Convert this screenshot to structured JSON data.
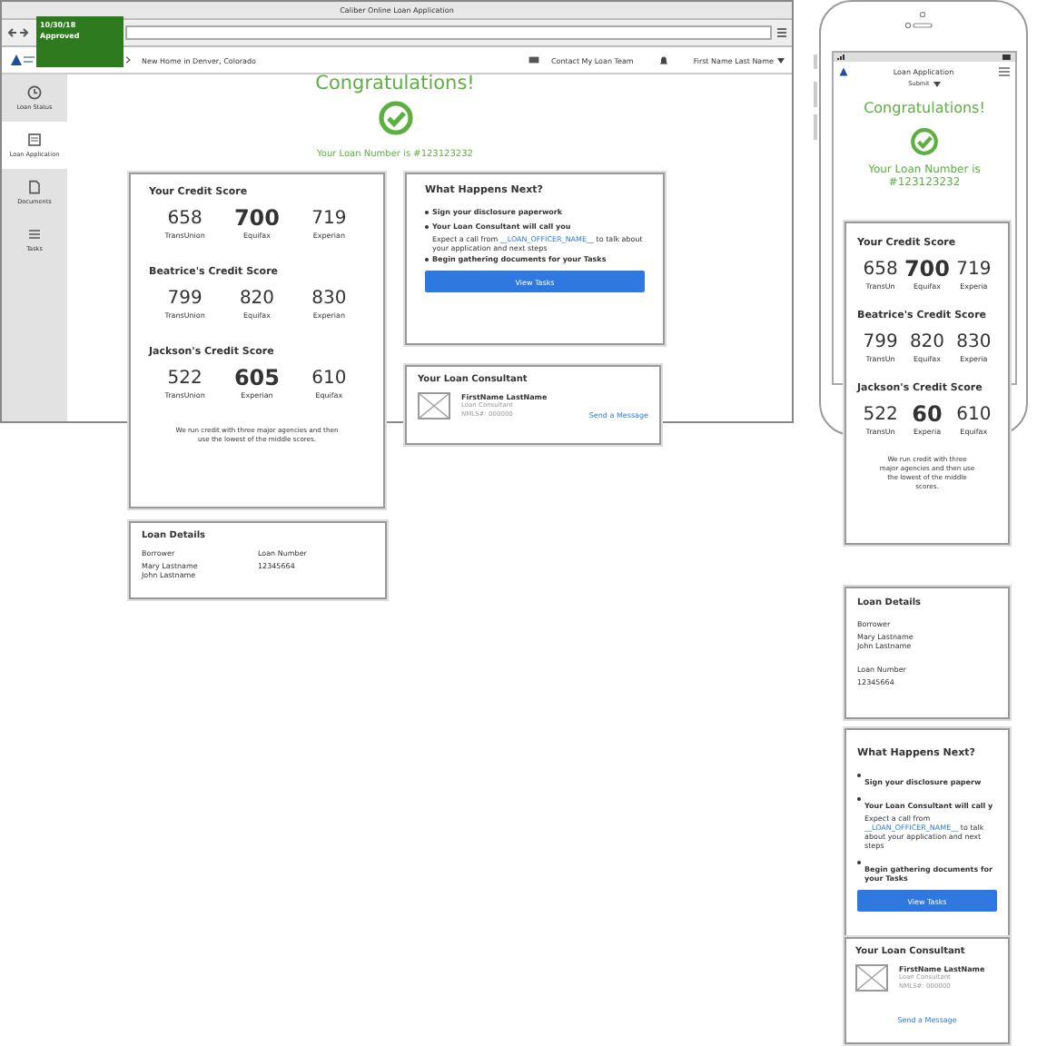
{
  "desktop": {
    "window_title": "Caliber Online Loan Application",
    "sticky_note": {
      "date": "10/30/18",
      "status": "Approved"
    },
    "nav": {
      "breadcrumb": "New Home in Denver, Colorado",
      "contact": "Contact My Loan Team",
      "user": "First Name Last Name"
    },
    "sidebar": [
      {
        "label": "Loan Status",
        "selected": false
      },
      {
        "label": "Loan Application",
        "selected": true
      },
      {
        "label": "Documents",
        "selected": false
      },
      {
        "label": "Tasks",
        "selected": false
      }
    ],
    "congrats": {
      "title": "Congratulations!",
      "loan_number": "Your Loan Number is #123123232"
    },
    "credit": {
      "sections": [
        {
          "title": "Your Credit Score",
          "scores": [
            {
              "value": "658",
              "bureau": "TransUnion",
              "highlight": false
            },
            {
              "value": "700",
              "bureau": "Equifax",
              "highlight": true
            },
            {
              "value": "719",
              "bureau": "Experian",
              "highlight": false
            }
          ]
        },
        {
          "title": "Beatrice's Credit Score",
          "scores": [
            {
              "value": "799",
              "bureau": "TransUnion",
              "highlight": false
            },
            {
              "value": "820",
              "bureau": "Equifax",
              "highlight": false
            },
            {
              "value": "830",
              "bureau": "Experian",
              "highlight": false
            }
          ]
        },
        {
          "title": "Jackson's Credit Score",
          "scores": [
            {
              "value": "522",
              "bureau": "TransUnion",
              "highlight": false
            },
            {
              "value": "605",
              "bureau": "Experian",
              "highlight": true
            },
            {
              "value": "610",
              "bureau": "Equifax",
              "highlight": false
            }
          ]
        }
      ],
      "note": "We run credit with three major agencies and then use the lowest of the middle scores."
    },
    "next_steps": {
      "title": "What Happens Next?",
      "items": [
        {
          "text": "Sign your disclosure paperwork"
        },
        {
          "text": "Your Loan Consultant will call you",
          "detail": {
            "before": "Expect a call from",
            "link": "__LOAN_OFFICER_NAME__",
            "after": "to talk about your application and next steps"
          }
        },
        {
          "text": "Begin gathering documents for your Tasks"
        }
      ],
      "button": "View Tasks"
    },
    "consultant": {
      "title": "Your Loan Consultant",
      "name": "FirstName LastName",
      "role": "Loan Consultant",
      "nmls": "NMLS#: 000000",
      "link": "Send a Message"
    },
    "loan_details": {
      "title": "Loan Details",
      "borrower_label": "Borrower",
      "borrowers": [
        "Mary Lastname",
        "John Lastname"
      ],
      "number_label": "Loan Number",
      "number": "12345664"
    }
  },
  "mobile": {
    "header": "Loan Application",
    "menu": "Submit",
    "congrats": {
      "title": "Congratulations!",
      "loan_number": "Your Loan Number is #123123232"
    },
    "credit": {
      "sections": [
        {
          "title": "Your Credit Score",
          "scores": [
            {
              "value": "658",
              "bureau": "TransUn",
              "highlight": false
            },
            {
              "value": "700",
              "bureau": "Equifax",
              "highlight": true
            },
            {
              "value": "719",
              "bureau": "Experia",
              "highlight": false
            }
          ]
        },
        {
          "title": "Beatrice's Credit Score",
          "scores": [
            {
              "value": "799",
              "bureau": "TransUn",
              "highlight": false
            },
            {
              "value": "820",
              "bureau": "Equifax",
              "highlight": false
            },
            {
              "value": "830",
              "bureau": "Experia",
              "highlight": false
            }
          ]
        },
        {
          "title": "Jackson's Credit Score",
          "scores": [
            {
              "value": "522",
              "bureau": "TransUn",
              "highlight": false
            },
            {
              "value": "60",
              "bureau": "Experia",
              "highlight": true
            },
            {
              "value": "610",
              "bureau": "Equifax",
              "highlight": false
            }
          ]
        }
      ],
      "note": "We run credit with three major agencies and then use the lowest of the middle scores."
    },
    "loan_details": {
      "title": "Loan Details",
      "borrower_label": "Borrower",
      "borrowers": [
        "Mary Lastname",
        "John Lastname"
      ],
      "number_label": "Loan Number",
      "number": "12345664"
    },
    "next_steps": {
      "title": "What Happens Next?",
      "items": [
        {
          "text": "Sign your disclosure paperw"
        },
        {
          "text": "Your Loan Consultant will call y",
          "detail": {
            "before": "Expect a call from",
            "link": "__LOAN_OFFICER_NAME__",
            "after": "to talk about your application and next steps"
          }
        },
        {
          "text": "Begin gathering documents for your Tasks"
        }
      ],
      "button": "View Tasks"
    },
    "consultant": {
      "title": "Your Loan Consultant",
      "name": "FirstName LastName",
      "role": "Loan Consultant",
      "nmls": "NMLS#: 000000",
      "link": "Send a Message"
    }
  }
}
